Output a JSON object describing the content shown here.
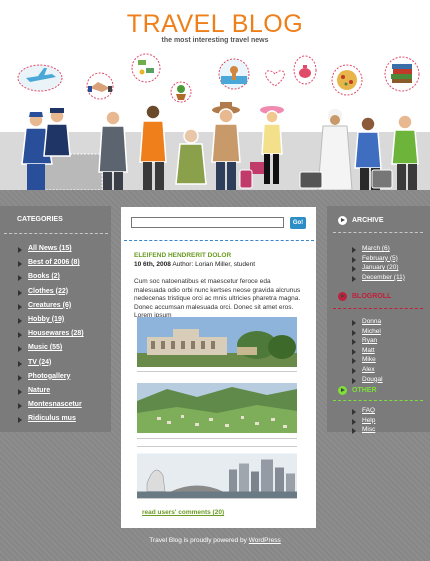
{
  "header": {
    "title": "TRAVEL BLOG",
    "tagline": "the most interesting travel news"
  },
  "search": {
    "placeholder": "",
    "button_label": "Go!"
  },
  "categories": {
    "title": "CATEGORIES",
    "items": [
      "All News (15)",
      "Best of 2006 (8)",
      "Books (2)",
      "Clothes (22)",
      "Creatures (6)",
      "Hobby (19)",
      "Housewares (28)",
      "Music (55)",
      "TV (24)",
      "Photogallery",
      "Nature",
      "Montesnascetur",
      "Ridiculus mus"
    ]
  },
  "archive": {
    "title": "ARCHIVE",
    "items": [
      "March (6)",
      "February (5)",
      "January (20)",
      "December (11)"
    ]
  },
  "blogroll": {
    "title": "BLOGROLL",
    "items": [
      "Donna",
      "Michel",
      "Ryan",
      "Matt",
      "Mike",
      "Alex",
      "Dougal"
    ]
  },
  "other": {
    "title": "OTHER",
    "items": [
      "FAQ",
      "Help",
      "Misc"
    ]
  },
  "post": {
    "title": "ELEIFEND HENDRERIT DOLOR",
    "date": "10 6th, 2008",
    "author_label": "Author:",
    "author": "Lorian Miller, student",
    "body": "Cum soc natoenatibus et maescetur feroce eda malesuada odio orbi nunc kertses neose gravida alcrunus nedecenas tristique orci ac mnis ultricies pharetra magna. Donec accumsan malesuada orci. Donec sit amet eros. Lorem ipsum",
    "read_comments": "read users' comments (20)"
  },
  "footer": {
    "prefix": "Travel Blog is proudly powered by ",
    "link": "WordPress"
  },
  "colors": {
    "accent_orange": "#ee7f1a",
    "green": "#6a9a22",
    "blue": "#2d8ec6",
    "blogroll_red": "#c0203a",
    "other_green": "#7fdf3a"
  }
}
